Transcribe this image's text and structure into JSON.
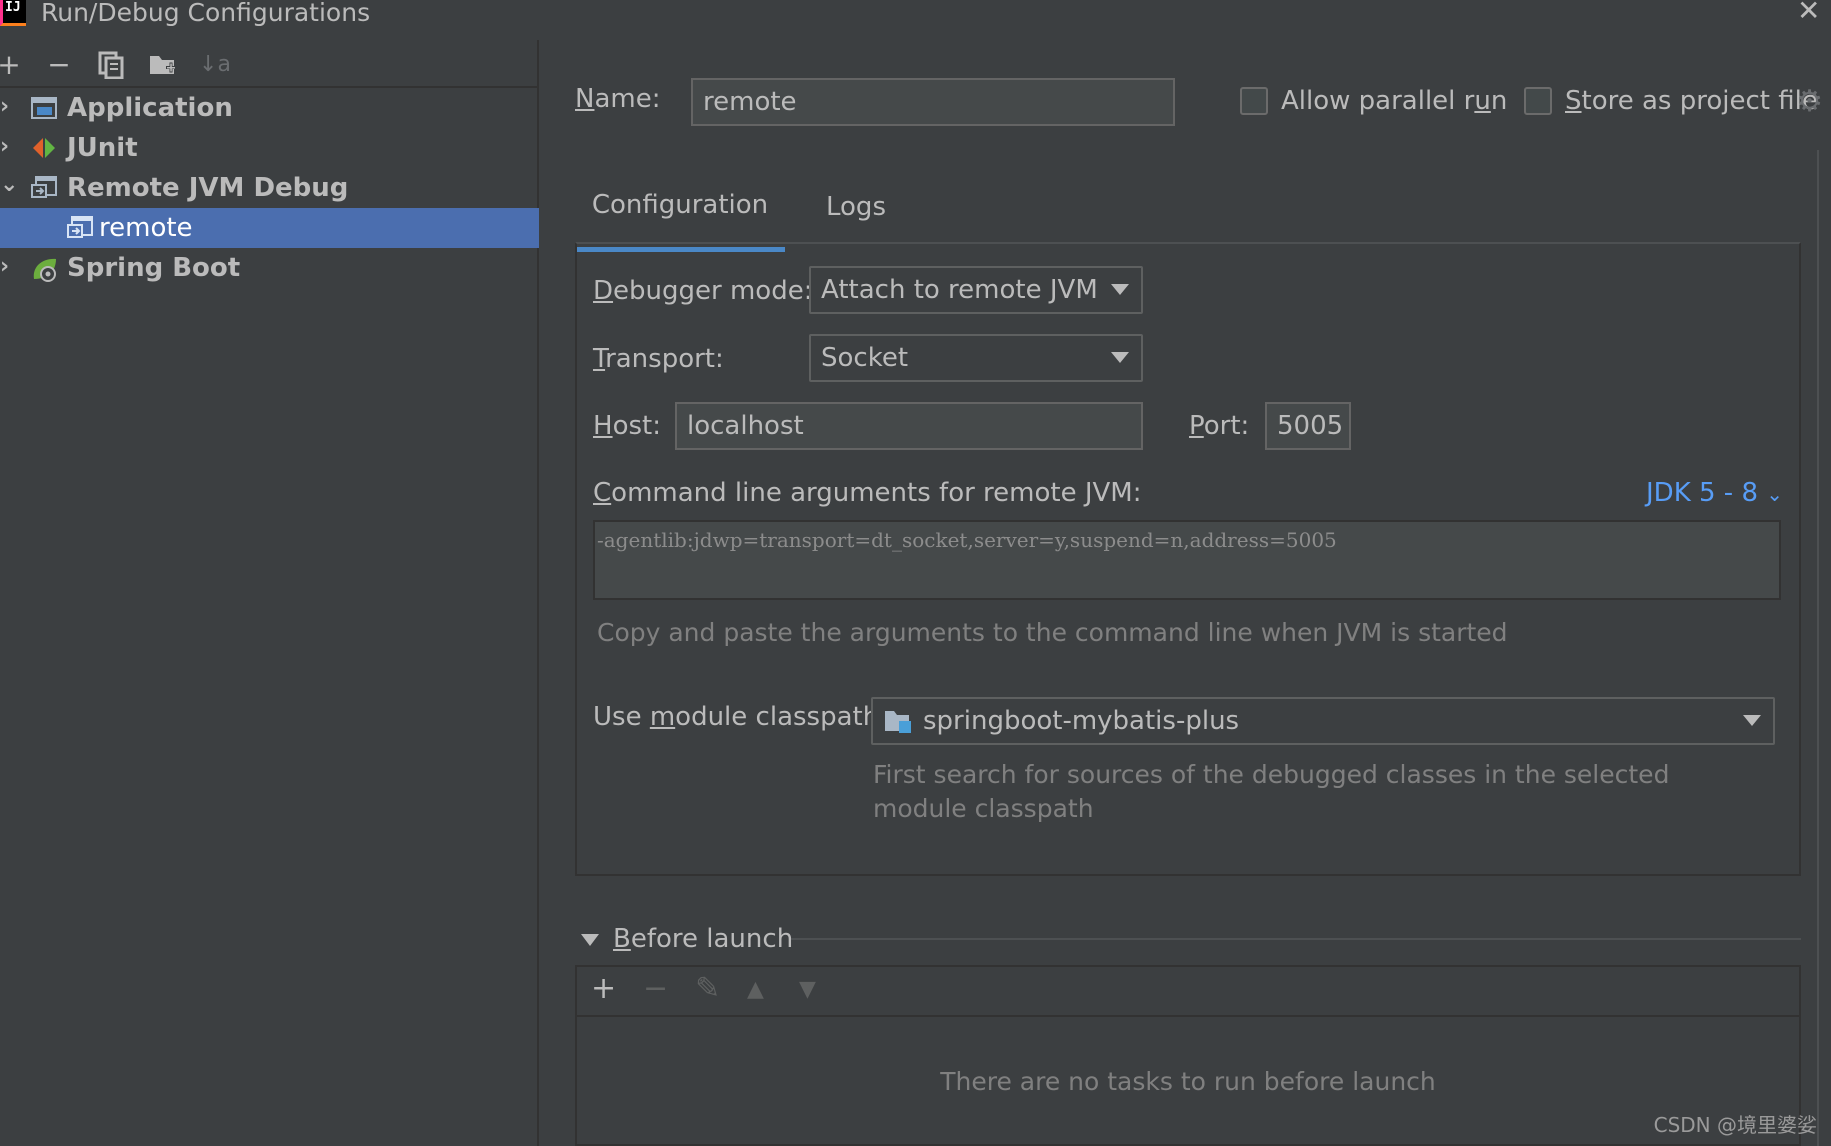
{
  "window": {
    "title": "Run/Debug Configurations",
    "close_glyph": "✕"
  },
  "toolbar": {
    "add": "+",
    "remove": "−",
    "copy": "⧉",
    "folder": "📁",
    "sort": "↓a"
  },
  "tree": {
    "items": [
      {
        "label": "Application",
        "expanded": false
      },
      {
        "label": "JUnit",
        "expanded": false
      },
      {
        "label": "Remote JVM Debug",
        "expanded": true
      },
      {
        "label": "remote",
        "selected": true
      },
      {
        "label": "Spring Boot",
        "expanded": false
      }
    ]
  },
  "header": {
    "name_label_pre": "N",
    "name_label_post": "ame:",
    "name_value": "remote",
    "parallel_pre": "Allow parallel r",
    "parallel_u": "u",
    "parallel_post": "n",
    "store_pre": "",
    "store_u": "S",
    "store_post": "tore as project file",
    "allow_parallel": false,
    "store_project": false
  },
  "tabs": [
    {
      "label": "Configuration",
      "active": true
    },
    {
      "label": "Logs",
      "active": false
    }
  ],
  "config": {
    "debugger_mode_u": "D",
    "debugger_mode_rest": "ebugger mode:",
    "debugger_mode_value": "Attach to remote JVM",
    "transport_u": "T",
    "transport_rest": "ransport:",
    "transport_value": "Socket",
    "host_u": "H",
    "host_rest": "ost:",
    "host_value": "localhost",
    "port_u": "P",
    "port_rest": "ort:",
    "port_value": "5005",
    "cmd_u": "C",
    "cmd_rest": "ommand line arguments for remote JVM:",
    "jdk_link": "JDK 5 - 8",
    "cmd_args": "-agentlib:jdwp=transport=dt_socket,server=y,suspend=n,address=5005",
    "cmd_hint": "Copy and paste the arguments to the command line when JVM is started",
    "module_pre": "Use ",
    "module_u": "m",
    "module_post": "odule classpath:",
    "module_value": "springboot-mybatis-plus",
    "module_hint_1": "First search for sources of the debugged classes in the selected",
    "module_hint_2": "module classpath"
  },
  "before_launch": {
    "title_u": "B",
    "title_rest": "efore launch",
    "empty_text": "There are no tasks to run before launch",
    "add": "+",
    "remove": "−",
    "edit": "✎",
    "up": "▲",
    "down": "▼"
  },
  "watermark": "CSDN @境里婆娑",
  "colors": {
    "background": "#3c3f41",
    "selection": "#4b6eaf",
    "tab_underline": "#4a88c7",
    "link": "#589df6"
  }
}
